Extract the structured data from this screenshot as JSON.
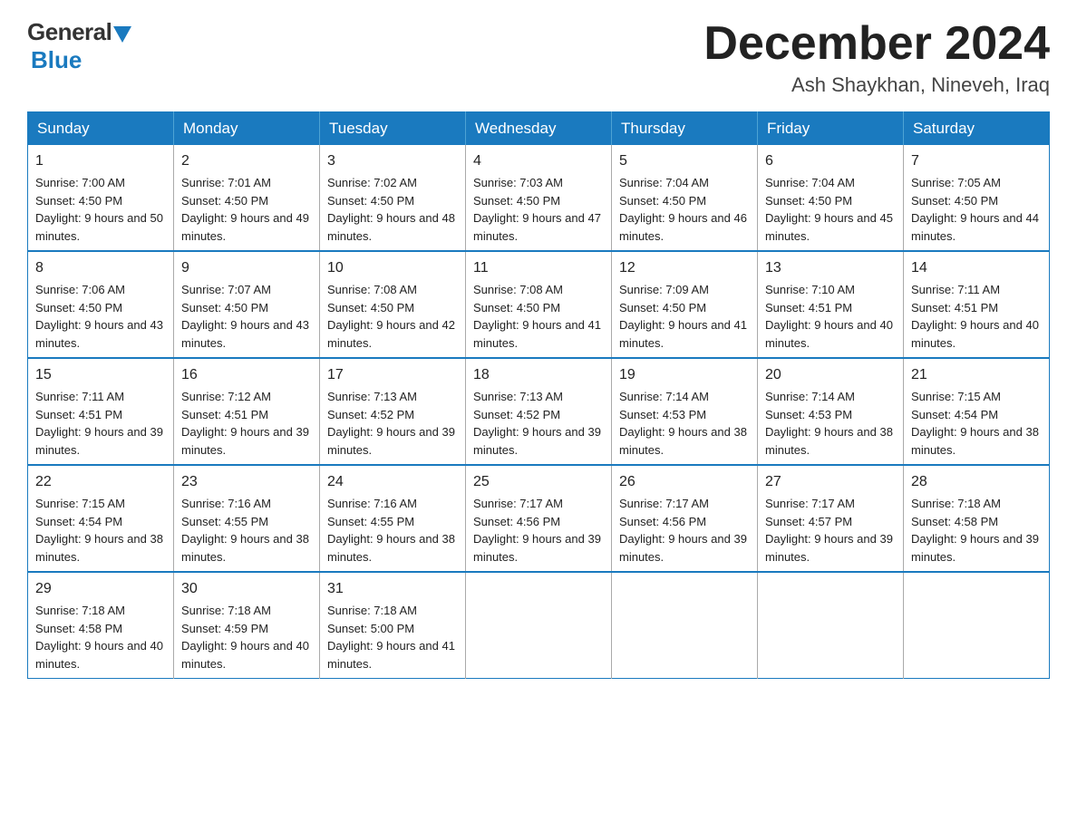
{
  "logo": {
    "general": "General",
    "blue": "Blue"
  },
  "title": "December 2024",
  "location": "Ash Shaykhan, Nineveh, Iraq",
  "weekdays": [
    "Sunday",
    "Monday",
    "Tuesday",
    "Wednesday",
    "Thursday",
    "Friday",
    "Saturday"
  ],
  "weeks": [
    [
      {
        "day": "1",
        "sunrise": "7:00 AM",
        "sunset": "4:50 PM",
        "daylight": "9 hours and 50 minutes."
      },
      {
        "day": "2",
        "sunrise": "7:01 AM",
        "sunset": "4:50 PM",
        "daylight": "9 hours and 49 minutes."
      },
      {
        "day": "3",
        "sunrise": "7:02 AM",
        "sunset": "4:50 PM",
        "daylight": "9 hours and 48 minutes."
      },
      {
        "day": "4",
        "sunrise": "7:03 AM",
        "sunset": "4:50 PM",
        "daylight": "9 hours and 47 minutes."
      },
      {
        "day": "5",
        "sunrise": "7:04 AM",
        "sunset": "4:50 PM",
        "daylight": "9 hours and 46 minutes."
      },
      {
        "day": "6",
        "sunrise": "7:04 AM",
        "sunset": "4:50 PM",
        "daylight": "9 hours and 45 minutes."
      },
      {
        "day": "7",
        "sunrise": "7:05 AM",
        "sunset": "4:50 PM",
        "daylight": "9 hours and 44 minutes."
      }
    ],
    [
      {
        "day": "8",
        "sunrise": "7:06 AM",
        "sunset": "4:50 PM",
        "daylight": "9 hours and 43 minutes."
      },
      {
        "day": "9",
        "sunrise": "7:07 AM",
        "sunset": "4:50 PM",
        "daylight": "9 hours and 43 minutes."
      },
      {
        "day": "10",
        "sunrise": "7:08 AM",
        "sunset": "4:50 PM",
        "daylight": "9 hours and 42 minutes."
      },
      {
        "day": "11",
        "sunrise": "7:08 AM",
        "sunset": "4:50 PM",
        "daylight": "9 hours and 41 minutes."
      },
      {
        "day": "12",
        "sunrise": "7:09 AM",
        "sunset": "4:50 PM",
        "daylight": "9 hours and 41 minutes."
      },
      {
        "day": "13",
        "sunrise": "7:10 AM",
        "sunset": "4:51 PM",
        "daylight": "9 hours and 40 minutes."
      },
      {
        "day": "14",
        "sunrise": "7:11 AM",
        "sunset": "4:51 PM",
        "daylight": "9 hours and 40 minutes."
      }
    ],
    [
      {
        "day": "15",
        "sunrise": "7:11 AM",
        "sunset": "4:51 PM",
        "daylight": "9 hours and 39 minutes."
      },
      {
        "day": "16",
        "sunrise": "7:12 AM",
        "sunset": "4:51 PM",
        "daylight": "9 hours and 39 minutes."
      },
      {
        "day": "17",
        "sunrise": "7:13 AM",
        "sunset": "4:52 PM",
        "daylight": "9 hours and 39 minutes."
      },
      {
        "day": "18",
        "sunrise": "7:13 AM",
        "sunset": "4:52 PM",
        "daylight": "9 hours and 39 minutes."
      },
      {
        "day": "19",
        "sunrise": "7:14 AM",
        "sunset": "4:53 PM",
        "daylight": "9 hours and 38 minutes."
      },
      {
        "day": "20",
        "sunrise": "7:14 AM",
        "sunset": "4:53 PM",
        "daylight": "9 hours and 38 minutes."
      },
      {
        "day": "21",
        "sunrise": "7:15 AM",
        "sunset": "4:54 PM",
        "daylight": "9 hours and 38 minutes."
      }
    ],
    [
      {
        "day": "22",
        "sunrise": "7:15 AM",
        "sunset": "4:54 PM",
        "daylight": "9 hours and 38 minutes."
      },
      {
        "day": "23",
        "sunrise": "7:16 AM",
        "sunset": "4:55 PM",
        "daylight": "9 hours and 38 minutes."
      },
      {
        "day": "24",
        "sunrise": "7:16 AM",
        "sunset": "4:55 PM",
        "daylight": "9 hours and 38 minutes."
      },
      {
        "day": "25",
        "sunrise": "7:17 AM",
        "sunset": "4:56 PM",
        "daylight": "9 hours and 39 minutes."
      },
      {
        "day": "26",
        "sunrise": "7:17 AM",
        "sunset": "4:56 PM",
        "daylight": "9 hours and 39 minutes."
      },
      {
        "day": "27",
        "sunrise": "7:17 AM",
        "sunset": "4:57 PM",
        "daylight": "9 hours and 39 minutes."
      },
      {
        "day": "28",
        "sunrise": "7:18 AM",
        "sunset": "4:58 PM",
        "daylight": "9 hours and 39 minutes."
      }
    ],
    [
      {
        "day": "29",
        "sunrise": "7:18 AM",
        "sunset": "4:58 PM",
        "daylight": "9 hours and 40 minutes."
      },
      {
        "day": "30",
        "sunrise": "7:18 AM",
        "sunset": "4:59 PM",
        "daylight": "9 hours and 40 minutes."
      },
      {
        "day": "31",
        "sunrise": "7:18 AM",
        "sunset": "5:00 PM",
        "daylight": "9 hours and 41 minutes."
      },
      null,
      null,
      null,
      null
    ]
  ]
}
